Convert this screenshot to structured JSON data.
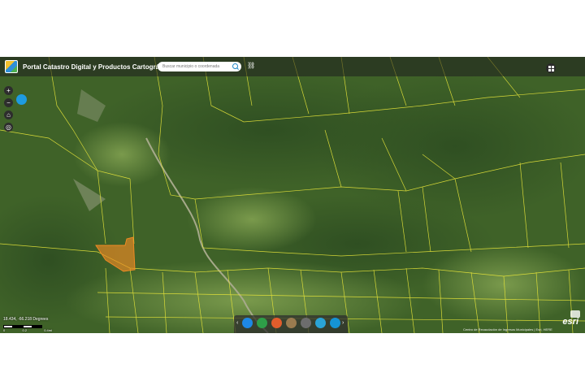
{
  "header": {
    "title": "Portal Catastro Digital y Productos Cartográficos"
  },
  "search": {
    "placeholder": "Buscar municipio o coordenada"
  },
  "map": {
    "coordinates": "18.434, -66.218 Degrees",
    "scale_labels": [
      "0",
      "0.2",
      "0.4mi"
    ],
    "attribution": "Centro de Recaudación de Ingresos Municipales | Esri, HERE",
    "esri_logo": "esri",
    "highlight_color": "#f08a24",
    "parcel_line_color": "#e8e63a"
  },
  "toolbar": {
    "zoom_in": "+",
    "zoom_out": "−",
    "home_icon": "home-icon",
    "locate_icon": "locate-icon",
    "layers_icon": "layers-icon"
  },
  "widgets": [
    {
      "icon": "basemap-icon",
      "color": "#1e88e5"
    },
    {
      "icon": "bookmark-icon",
      "color": "#2e9e48"
    },
    {
      "icon": "measure-icon",
      "color": "#e25d2c"
    },
    {
      "icon": "layer-list-icon",
      "color": "#9a7b4f"
    },
    {
      "icon": "legend-icon",
      "color": "#6d6d6d"
    },
    {
      "icon": "attribute-table-icon",
      "color": "#2aa3d6"
    },
    {
      "icon": "print-icon",
      "color": "#1593d5"
    }
  ]
}
